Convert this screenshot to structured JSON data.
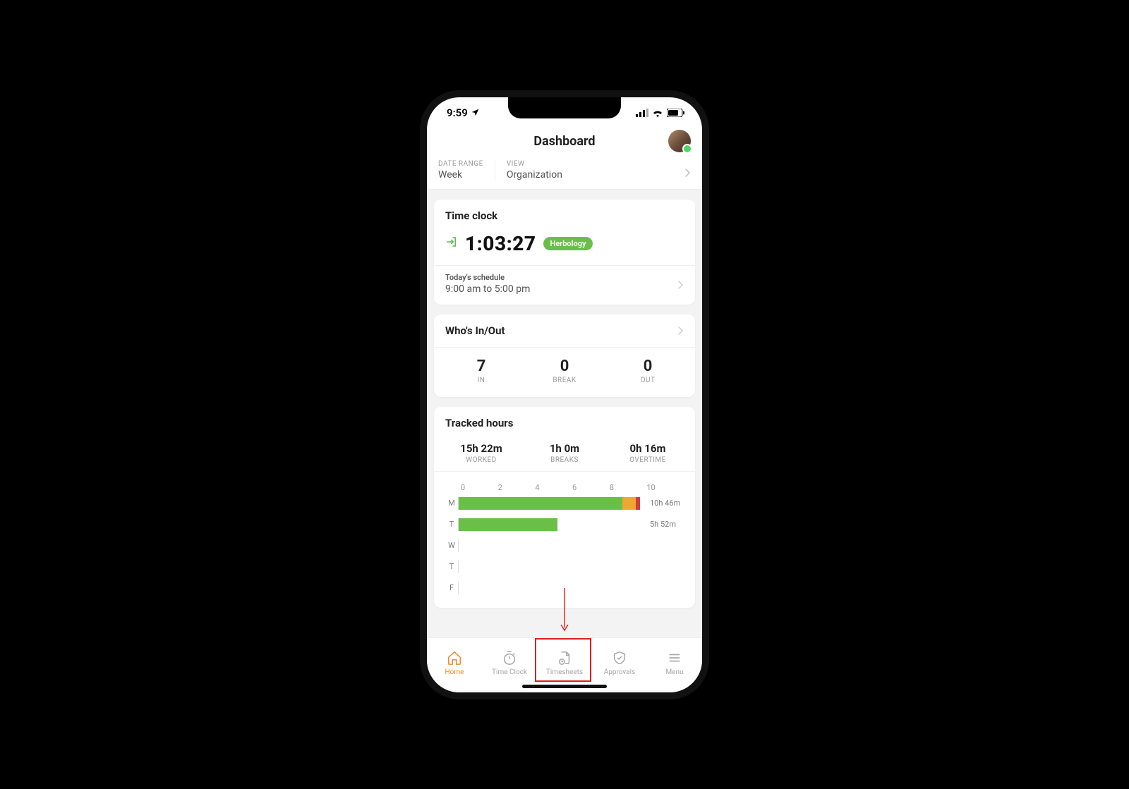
{
  "status_bar": {
    "time": "9:59"
  },
  "header": {
    "title": "Dashboard"
  },
  "filters": {
    "date_range_label": "DATE RANGE",
    "date_range_value": "Week",
    "view_label": "VIEW",
    "view_value": "Organization"
  },
  "time_clock": {
    "title": "Time clock",
    "elapsed": "1:03:27",
    "badge": "Herbology",
    "schedule_label": "Today's schedule",
    "schedule_value": "9:00 am to 5:00 pm"
  },
  "whos_in_out": {
    "title": "Who's In/Out",
    "in_count": "7",
    "in_label": "IN",
    "break_count": "0",
    "break_label": "BREAK",
    "out_count": "0",
    "out_label": "OUT"
  },
  "tracked_hours": {
    "title": "Tracked hours",
    "worked_value": "15h 22m",
    "worked_label": "WORKED",
    "breaks_value": "1h 0m",
    "breaks_label": "BREAKS",
    "overtime_value": "0h 16m",
    "overtime_label": "OVERTIME"
  },
  "chart_data": {
    "type": "bar",
    "xlabel": "",
    "ylabel": "",
    "categories": [
      "M",
      "T",
      "W",
      "T",
      "F"
    ],
    "ticks": [
      "0",
      "2",
      "4",
      "6",
      "8",
      "10"
    ],
    "xlim": [
      0,
      11
    ],
    "series": [
      {
        "name": "Worked",
        "color": "#6abf49",
        "values": [
          9.7,
          5.87,
          0,
          0,
          0
        ]
      },
      {
        "name": "Breaks",
        "color": "#f0a62f",
        "values": [
          0.8,
          0,
          0,
          0,
          0
        ]
      },
      {
        "name": "Overtime",
        "color": "#d33a3a",
        "values": [
          0.27,
          0,
          0,
          0,
          0
        ]
      }
    ],
    "totals": [
      "10h 46m",
      "5h 52m",
      "",
      "",
      ""
    ]
  },
  "bottom_nav": {
    "items": [
      {
        "label": "Home"
      },
      {
        "label": "Time Clock"
      },
      {
        "label": "Timesheets"
      },
      {
        "label": "Approvals"
      },
      {
        "label": "Menu"
      }
    ]
  }
}
